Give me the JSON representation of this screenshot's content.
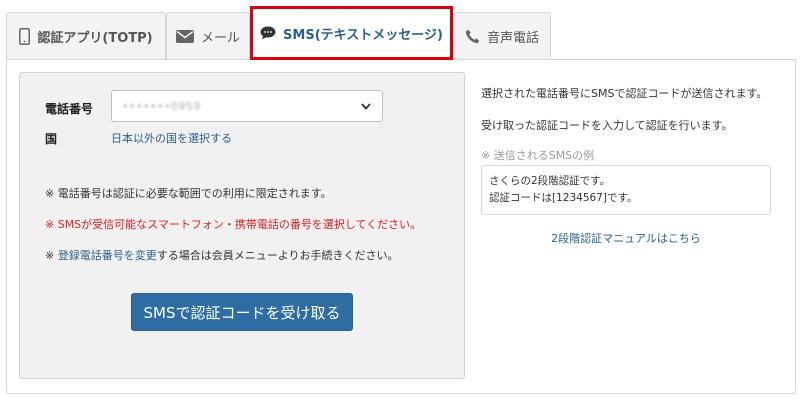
{
  "tabs": {
    "totp": "認証アプリ(TOTP)",
    "mail": "メール",
    "sms": "SMS(テキストメッセージ)",
    "voice": "音声電話"
  },
  "form": {
    "phone_label": "電話番号",
    "phone_value": "•••••••0959",
    "country_label": "国",
    "country_link": "日本以外の国を選択する"
  },
  "notes": {
    "note1": "※ 電話番号は認証に必要な範囲での利用に限定されます。",
    "note2": "※ SMSが受信可能なスマートフォン・携帯電話の番号を選択してください。",
    "note3_prefix": "※ ",
    "note3_link": "登録電話番号を変更",
    "note3_suffix": "する場合は会員メニューよりお手続きください。"
  },
  "submit_button": "SMSで認証コードを受け取る",
  "info": {
    "line1": "選択された電話番号にSMSで認証コードが送信されます。",
    "line2": "受け取った認証コードを入力して認証を行います。",
    "example_label": "※ 送信されるSMSの例",
    "example_line1": "さくらの2段階認証です。",
    "example_line2": "認証コードは[1234567]です。",
    "manual_link": "2段階認証マニュアルはこちら"
  },
  "colors": {
    "accent": "#2e6da4",
    "highlight": "#d9000f",
    "warning": "#e02020"
  }
}
